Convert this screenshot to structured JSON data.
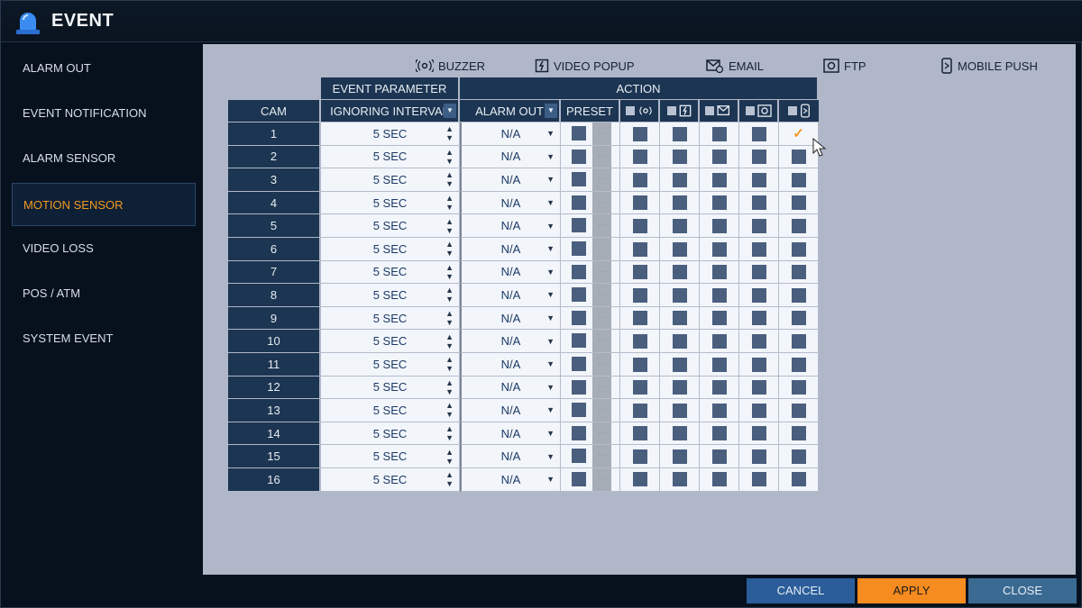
{
  "window": {
    "title": "EVENT"
  },
  "sidebar": {
    "items": [
      {
        "label": "ALARM OUT",
        "active": false
      },
      {
        "label": "EVENT NOTIFICATION",
        "active": false
      },
      {
        "label": "ALARM SENSOR",
        "active": false
      },
      {
        "label": "MOTION SENSOR",
        "active": true
      },
      {
        "label": "VIDEO LOSS",
        "active": false
      },
      {
        "label": "POS / ATM",
        "active": false
      },
      {
        "label": "SYSTEM EVENT",
        "active": false
      }
    ]
  },
  "legend": {
    "buzzer": "BUZZER",
    "video_popup": "VIDEO POPUP",
    "email": "EMAIL",
    "ftp": "FTP",
    "mobile_push": "MOBILE PUSH"
  },
  "table": {
    "group_event_parameter": "EVENT PARAMETER",
    "group_action": "ACTION",
    "col_cam": "CAM",
    "col_ignoring_interval": "IGNORING INTERVAL",
    "col_alarm_out": "ALARM OUT",
    "col_preset": "PRESET",
    "rows": [
      {
        "cam": "1",
        "interval": "5 SEC",
        "alarm_out": "N/A",
        "mobile_push": true
      },
      {
        "cam": "2",
        "interval": "5 SEC",
        "alarm_out": "N/A",
        "mobile_push": false
      },
      {
        "cam": "3",
        "interval": "5 SEC",
        "alarm_out": "N/A",
        "mobile_push": false
      },
      {
        "cam": "4",
        "interval": "5 SEC",
        "alarm_out": "N/A",
        "mobile_push": false
      },
      {
        "cam": "5",
        "interval": "5 SEC",
        "alarm_out": "N/A",
        "mobile_push": false
      },
      {
        "cam": "6",
        "interval": "5 SEC",
        "alarm_out": "N/A",
        "mobile_push": false
      },
      {
        "cam": "7",
        "interval": "5 SEC",
        "alarm_out": "N/A",
        "mobile_push": false
      },
      {
        "cam": "8",
        "interval": "5 SEC",
        "alarm_out": "N/A",
        "mobile_push": false
      },
      {
        "cam": "9",
        "interval": "5 SEC",
        "alarm_out": "N/A",
        "mobile_push": false
      },
      {
        "cam": "10",
        "interval": "5 SEC",
        "alarm_out": "N/A",
        "mobile_push": false
      },
      {
        "cam": "11",
        "interval": "5 SEC",
        "alarm_out": "N/A",
        "mobile_push": false
      },
      {
        "cam": "12",
        "interval": "5 SEC",
        "alarm_out": "N/A",
        "mobile_push": false
      },
      {
        "cam": "13",
        "interval": "5 SEC",
        "alarm_out": "N/A",
        "mobile_push": false
      },
      {
        "cam": "14",
        "interval": "5 SEC",
        "alarm_out": "N/A",
        "mobile_push": false
      },
      {
        "cam": "15",
        "interval": "5 SEC",
        "alarm_out": "N/A",
        "mobile_push": false
      },
      {
        "cam": "16",
        "interval": "5 SEC",
        "alarm_out": "N/A",
        "mobile_push": false
      }
    ]
  },
  "footer": {
    "cancel": "CANCEL",
    "apply": "APPLY",
    "close": "CLOSE"
  },
  "colors": {
    "accent_orange": "#f39a1e",
    "header_navy": "#1c3552",
    "checkbox_fill": "#4a5f7e",
    "content_bg": "#b0b7c9"
  }
}
